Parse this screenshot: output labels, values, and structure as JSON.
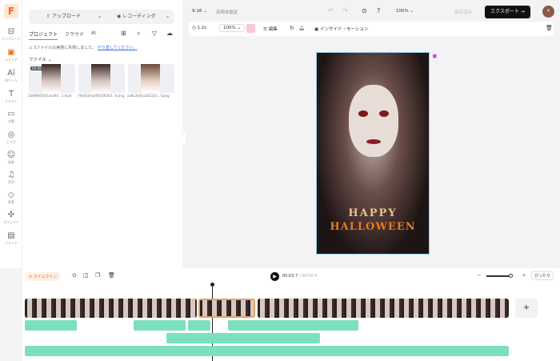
{
  "rail": {
    "logo": "F",
    "items": [
      {
        "icon": "⊟",
        "label": "テンプレート"
      },
      {
        "icon": "▣",
        "label": "メディア"
      },
      {
        "icon": "Aï",
        "label": "AIツール"
      },
      {
        "icon": "T",
        "label": "テキスト"
      },
      {
        "icon": "▭",
        "label": "字幕"
      },
      {
        "icon": "◎",
        "label": "ビデオ"
      },
      {
        "icon": "☺",
        "label": "画像"
      },
      {
        "icon": "♫",
        "label": "音声"
      },
      {
        "icon": "◇",
        "label": "要素"
      },
      {
        "icon": "✣",
        "label": "エフェクト"
      },
      {
        "icon": "▤",
        "label": "ブランド"
      }
    ]
  },
  "panel": {
    "upload": "アップロード",
    "record": "レコーディング",
    "tabs": [
      "プロジェクト",
      "クラウド",
      "AI"
    ],
    "warning": "3ファイルの実態に失敗しました。",
    "retry": "やり直してください。",
    "files_label": "ファイル",
    "files": [
      {
        "name": "1b6f9b0f341aca04...1.mp4",
        "duration": "00:09"
      },
      {
        "name": "79a633ea2091465b3...0.png"
      },
      {
        "name": "a38c2b41a2b211b...f.jpeg"
      }
    ]
  },
  "topbar": {
    "ratio": "9:16",
    "title": "名称未設定",
    "zoom": "100%",
    "saved": "保存済み",
    "export": "エクスポート",
    "avatar": "X"
  },
  "tools": {
    "duration": "1.2s",
    "scale": "100%",
    "edit": "編集",
    "motion": "インサイド・モーション"
  },
  "preview": {
    "line1": "HAPPY",
    "line2": "HALLOWEEN"
  },
  "timeline": {
    "label": "タイムライン",
    "current": "00:03.7",
    "total": "00:09.4",
    "fit": "ぴったり",
    "add": "+"
  }
}
